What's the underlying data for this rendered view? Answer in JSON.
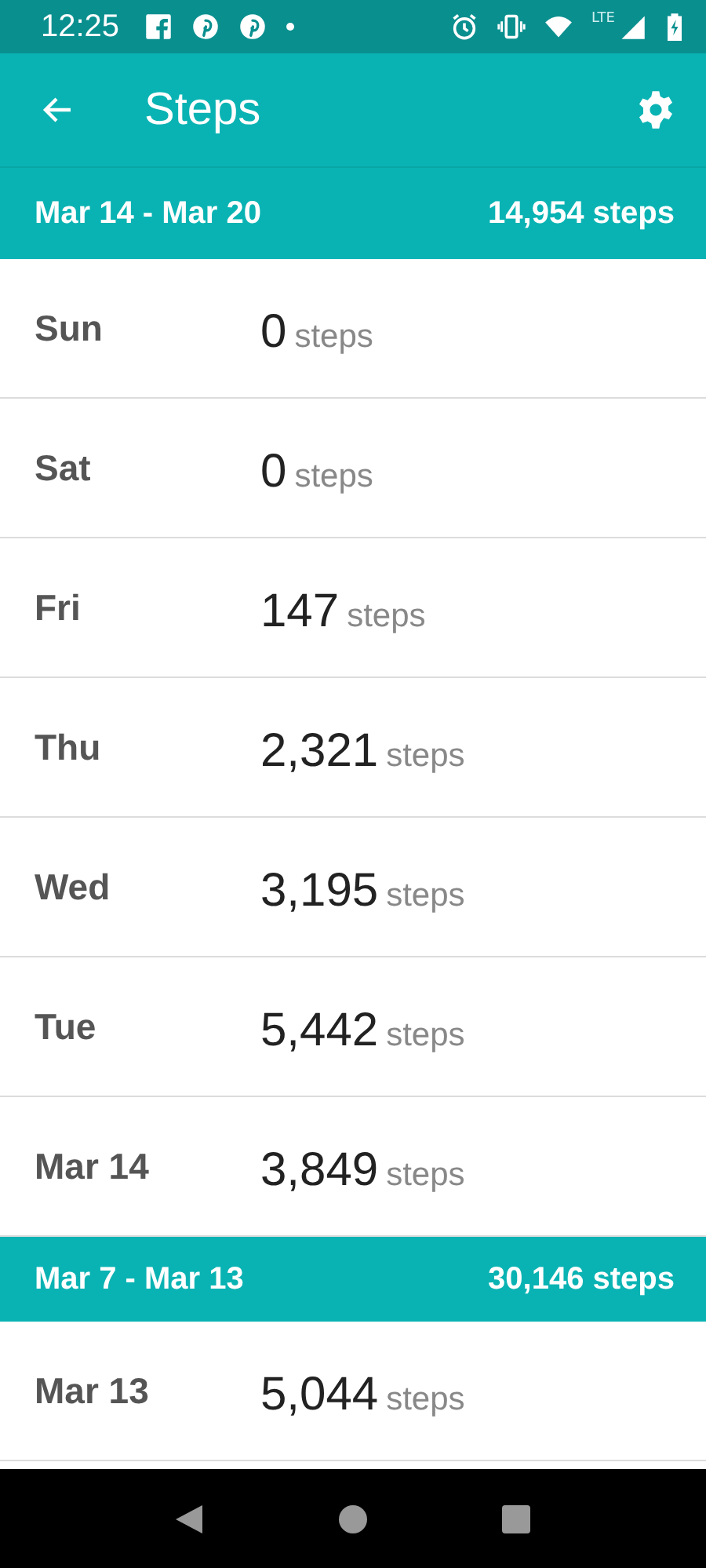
{
  "status_bar": {
    "time": "12:25",
    "network": "LTE"
  },
  "app_bar": {
    "title": "Steps"
  },
  "weeks": [
    {
      "range": "Mar 14 - Mar 20",
      "total": "14,954 steps",
      "days": [
        {
          "label": "Sun",
          "count": "0",
          "unit": "steps"
        },
        {
          "label": "Sat",
          "count": "0",
          "unit": "steps"
        },
        {
          "label": "Fri",
          "count": "147",
          "unit": "steps"
        },
        {
          "label": "Thu",
          "count": "2,321",
          "unit": "steps"
        },
        {
          "label": "Wed",
          "count": "3,195",
          "unit": "steps"
        },
        {
          "label": "Tue",
          "count": "5,442",
          "unit": "steps"
        },
        {
          "label": "Mar 14",
          "count": "3,849",
          "unit": "steps"
        }
      ]
    },
    {
      "range": "Mar 7 - Mar 13",
      "total": "30,146 steps",
      "days": [
        {
          "label": "Mar 13",
          "count": "5,044",
          "unit": "steps"
        }
      ]
    }
  ]
}
